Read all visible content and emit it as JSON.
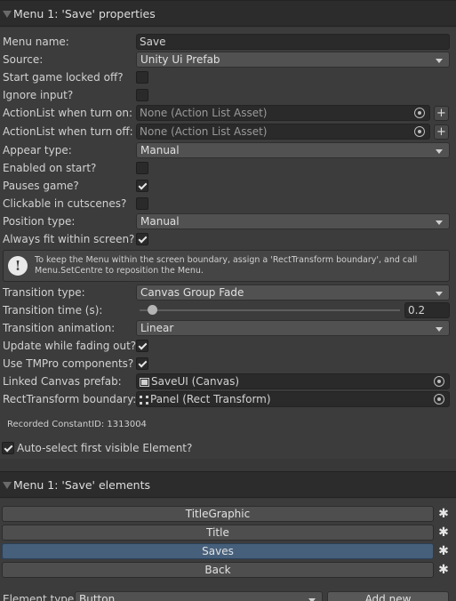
{
  "properties_header": {
    "title": "Menu 1: 'Save' properties"
  },
  "menu_name": {
    "label": "Menu name:",
    "value": "Save"
  },
  "source": {
    "label": "Source:",
    "value": "Unity Ui Prefab"
  },
  "start_locked_off": {
    "label": "Start game locked off?",
    "checked": false
  },
  "ignore_input": {
    "label": "Ignore input?",
    "checked": false
  },
  "actionlist_on": {
    "label": "ActionList when turn on:",
    "value": "None (Action List Asset)",
    "add": "+"
  },
  "actionlist_off": {
    "label": "ActionList when turn off:",
    "value": "None (Action List Asset)",
    "add": "+"
  },
  "appear_type": {
    "label": "Appear type:",
    "value": "Manual"
  },
  "enabled_on_start": {
    "label": "Enabled on start?",
    "checked": false
  },
  "pauses_game": {
    "label": "Pauses game?",
    "checked": true
  },
  "clickable_cutscenes": {
    "label": "Clickable in cutscenes?",
    "checked": false
  },
  "position_type": {
    "label": "Position type:",
    "value": "Manual"
  },
  "always_fit": {
    "label": "Always fit within screen?",
    "checked": true
  },
  "help_box": {
    "icon": "!",
    "text": "To keep the Menu within the screen boundary, assign a 'RectTransform boundary', and call Menu.SetCentre to reposition the Menu."
  },
  "transition_type": {
    "label": "Transition type:",
    "value": "Canvas Group Fade"
  },
  "transition_time": {
    "label": "Transition time (s):",
    "value": "0.2",
    "slider_fraction": 0.05
  },
  "transition_animation": {
    "label": "Transition animation:",
    "value": "Linear"
  },
  "update_fading": {
    "label": "Update while fading out?",
    "checked": true
  },
  "use_tmpro": {
    "label": "Use TMPro components?",
    "checked": true
  },
  "linked_canvas": {
    "label": "Linked Canvas prefab:",
    "value": "SaveUI (Canvas)"
  },
  "rect_boundary": {
    "label": "RectTransform boundary:",
    "value": "Panel (Rect Transform)"
  },
  "constant_id": {
    "text": "Recorded ConstantID: 1313004"
  },
  "auto_select": {
    "label": "Auto-select first visible Element?",
    "checked": true
  },
  "elements_header": {
    "title": "Menu 1: 'Save' elements"
  },
  "elements": [
    {
      "label": "TitleGraphic",
      "selected": false
    },
    {
      "label": "Title",
      "selected": false
    },
    {
      "label": "Saves",
      "selected": true
    },
    {
      "label": "Back",
      "selected": false
    }
  ],
  "element_type": {
    "label": "Element type:",
    "value": "Button"
  },
  "add_new": {
    "label": "Add new"
  },
  "colors": {
    "background": "#383838",
    "field": "#2a2a2a",
    "popup": "#515151",
    "selected_element": "#46607c"
  },
  "icons": {
    "foldout": "triangle-down",
    "object_picker": "target-circle",
    "element_settings": "gear",
    "help": "exclamation-circle",
    "canvas": "canvas-icon",
    "rect_transform": "rect-transform-icon"
  }
}
